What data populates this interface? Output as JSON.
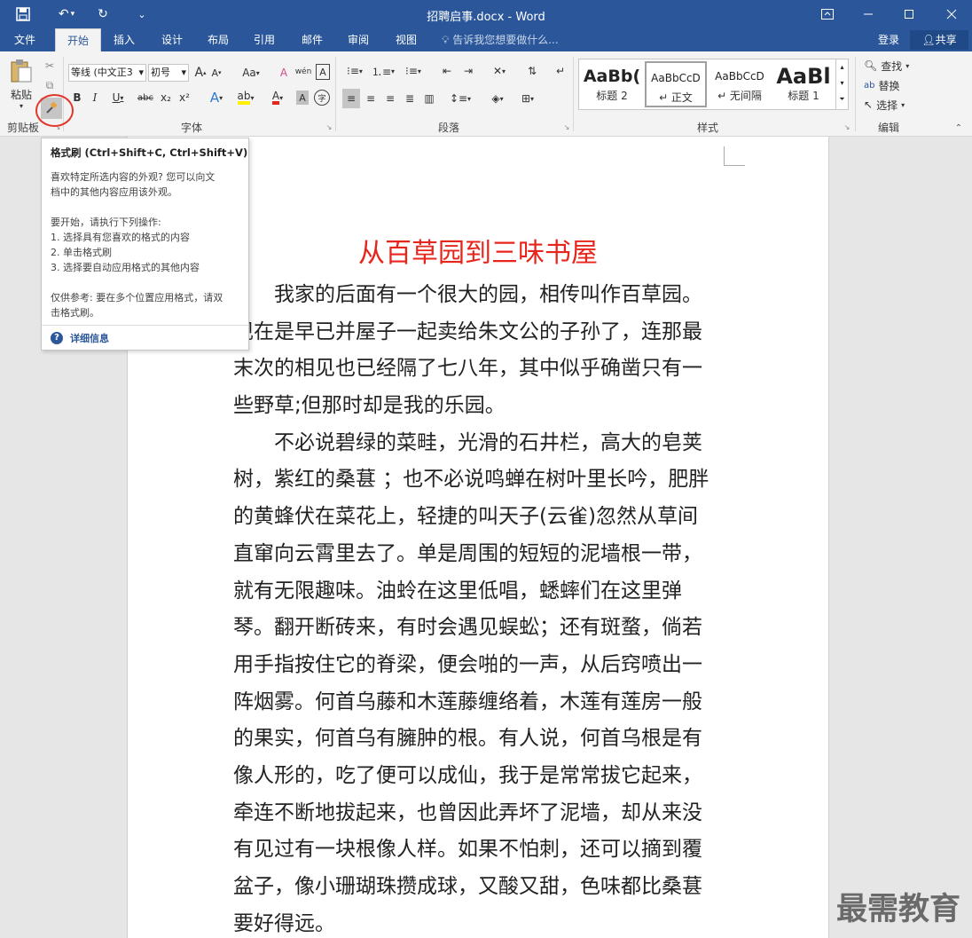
{
  "titlebar": {
    "title": "招聘启事.docx - Word",
    "qa_save": "▭",
    "qa_undo": "↶",
    "qa_redo": "↻",
    "qa_custom": "⌄"
  },
  "tabs": [
    "文件",
    "开始",
    "插入",
    "设计",
    "布局",
    "引用",
    "邮件",
    "审阅",
    "视图"
  ],
  "tell_me": "告诉我您想要做什么...",
  "account": {
    "login": "登录",
    "share": "共享"
  },
  "ribbon": {
    "clipboard": {
      "paste": "粘贴",
      "group": "剪贴板"
    },
    "font": {
      "name": "等线 (中文正3",
      "size": "初号",
      "group": "字体",
      "bold": "B",
      "italic": "I",
      "underline": "U",
      "strike": "abc",
      "sub": "x₂",
      "sup": "x²",
      "grow": "A",
      "shrink": "A",
      "case": "Aa",
      "clear": "A",
      "phonetic": "wén",
      "border": "A",
      "effects": "A",
      "highlight": "ab",
      "fontcolor": "A",
      "shade": "A",
      "enclose": "字"
    },
    "paragraph": {
      "group": "段落"
    },
    "styles": {
      "group": "样式",
      "items": [
        {
          "sample": "AaBb(",
          "name": "标题 2"
        },
        {
          "sample": "AaBbCcD",
          "name": "↵ 正文"
        },
        {
          "sample": "AaBbCcD",
          "name": "↵ 无间隔"
        },
        {
          "sample": "AaBl",
          "name": "标题 1"
        }
      ]
    },
    "editing": {
      "group": "编辑",
      "find": "查找",
      "replace": "替换",
      "select": "选择"
    }
  },
  "tooltip": {
    "title": "格式刷 (Ctrl+Shift+C, Ctrl+Shift+V)",
    "desc1": "喜欢特定所选内容的外观? 您可以向文",
    "desc2": "档中的其他内容应用该外观。",
    "start": "要开始，请执行下列操作:",
    "step1": "1. 选择具有您喜欢的格式的内容",
    "step2": "2. 单击格式刷",
    "step3": "3. 选择要自动应用格式的其他内容",
    "ref1": "仅供参考: 要在多个位置应用格式，请双",
    "ref2": "击格式刷。",
    "more": "详细信息"
  },
  "document": {
    "heading": "从百草园到三味书屋",
    "lines": [
      "　　我家的后面有一个很大的园，相传叫作百草园。",
      "现在是早已并屋子一起卖给朱文公的子孙了，连那最",
      "末次的相见也已经隔了七八年，其中似乎确凿只有一",
      "些野草;但那时却是我的乐园。",
      "　　不必说碧绿的菜畦，光滑的石井栏，高大的皂荚",
      "树，紫红的桑葚 ；也不必说鸣蝉在树叶里长吟，肥胖",
      "的黄蜂伏在菜花上，轻捷的叫天子(云雀)忽然从草间",
      "直窜向云霄里去了。单是周围的短短的泥墙根一带，",
      "就有无限趣味。油蛉在这里低唱，蟋蟀们在这里弹",
      "琴。翻开断砖来，有时会遇见蜈蚣；还有斑蝥，倘若",
      "用手指按住它的脊梁，便会啪的一声，从后窍喷出一",
      "阵烟雾。何首乌藤和木莲藤缠络着，木莲有莲房一般",
      "的果实，何首乌有臃肿的根。有人说，何首乌根是有",
      "像人形的，吃了便可以成仙，我于是常常拔它起来，",
      "牵连不断地拔起来，也曾因此弄坏了泥墙，却从来没",
      "有见过有一块根像人样。如果不怕刺，还可以摘到覆",
      "盆子，像小珊瑚珠攒成球，又酸又甜，色味都比桑葚",
      "要好得远。"
    ]
  },
  "watermark": "最需教育"
}
